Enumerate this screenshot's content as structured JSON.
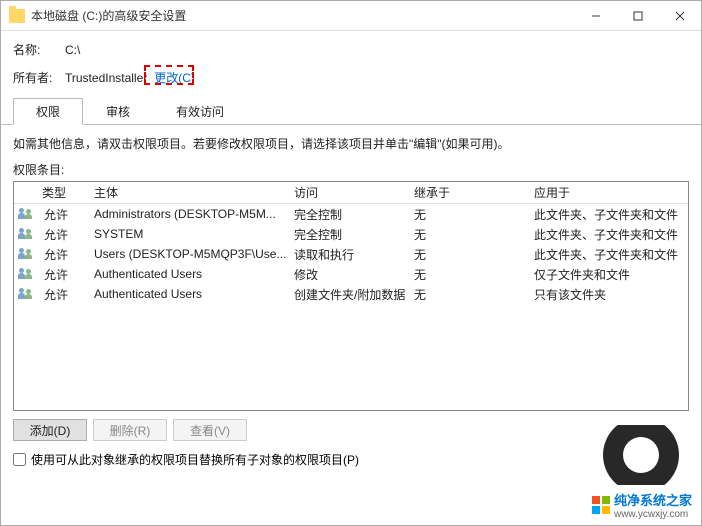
{
  "window": {
    "title": "本地磁盘 (C:)的高级安全设置"
  },
  "header": {
    "name_label": "名称:",
    "name_value": "C:\\",
    "owner_label": "所有者:",
    "owner_value": "TrustedInstaller",
    "change_label": "更改(C)"
  },
  "tabs": [
    {
      "label": "权限",
      "active": true
    },
    {
      "label": "审核",
      "active": false
    },
    {
      "label": "有效访问",
      "active": false
    }
  ],
  "instruction": "如需其他信息，请双击权限项目。若要修改权限项目，请选择该项目并单击\"编辑\"(如果可用)。",
  "perm_label": "权限条目:",
  "columns": {
    "type": "类型",
    "principal": "主体",
    "access": "访问",
    "inherit": "继承于",
    "applies": "应用于"
  },
  "entries": [
    {
      "type": "允许",
      "principal": "Administrators (DESKTOP-M5M...",
      "access": "完全控制",
      "inherit": "无",
      "applies": "此文件夹、子文件夹和文件"
    },
    {
      "type": "允许",
      "principal": "SYSTEM",
      "access": "完全控制",
      "inherit": "无",
      "applies": "此文件夹、子文件夹和文件"
    },
    {
      "type": "允许",
      "principal": "Users (DESKTOP-M5MQP3F\\Use...",
      "access": "读取和执行",
      "inherit": "无",
      "applies": "此文件夹、子文件夹和文件"
    },
    {
      "type": "允许",
      "principal": "Authenticated Users",
      "access": "修改",
      "inherit": "无",
      "applies": "仅子文件夹和文件"
    },
    {
      "type": "允许",
      "principal": "Authenticated Users",
      "access": "创建文件夹/附加数据",
      "inherit": "无",
      "applies": "只有该文件夹"
    }
  ],
  "buttons": {
    "add": "添加(D)",
    "remove": "删除(R)",
    "view": "查看(V)"
  },
  "checkbox_label": "使用可从此对象继承的权限项目替换所有子对象的权限项目(P)",
  "watermark": {
    "text": "纯净系统之家",
    "url": "www.ycwxjy.com"
  }
}
